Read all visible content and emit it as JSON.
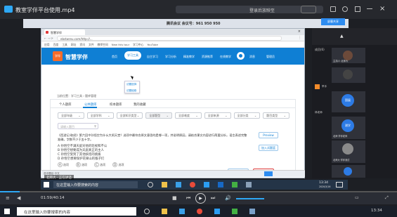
{
  "player": {
    "title": "教室学伴平台使用.mp4",
    "meeting": "腾讯会议",
    "controls": "登录后放映至",
    "close": "×"
  },
  "meeting": {
    "title": "腾讯会议 会议号：961 950 950",
    "share_label": "屏幕共享"
  },
  "browser": {
    "tab": "智慧学伴",
    "url": "ebstwreu.com/http://...",
    "bookmarks": [
      "应用",
      "百度",
      "工具",
      "网址",
      "资讯",
      "文件",
      "教师空间",
      "New this tour",
      "学习中心",
      "YouTube"
    ],
    "brand_short": "学伴",
    "brand": "智慧学伴",
    "nav": [
      "首页",
      "学习工具",
      "自主学习",
      "学习分析",
      "精准教学",
      "资源推荐",
      "在线教学"
    ],
    "nav_active": 1,
    "nav_right": [
      "消息",
      "管理员"
    ],
    "dropdown": [
      "试题选择",
      "试题组卷"
    ],
    "breadcrumb": "当前位置：学习工具 › 题库管理",
    "tabs": [
      "个人题库",
      "公共题库",
      "校本题库",
      "我的收藏"
    ],
    "tab_active": 1,
    "filters": [
      "全部年级",
      "全部学科",
      "全部知识类型",
      "全部题型",
      "全部难度",
      "全部来源",
      "全部分类",
      "题目类型"
    ],
    "search_placeholder": "请输入题目",
    "question": "《西游记·取经》第六回中孙悟空为什么大闹天宫？选项中最符合原文意思的是哪一项，并说明原因，请结合课文内容进行简要分析，语言表述完整准确，字数不少于五十字。",
    "options": [
      "A 孙悟空不满天庭对他的轻视和不公",
      "B 孙悟空想要成为天庭真正的主人",
      "C 孙悟空受到了其他妖怪的挑拨",
      "D 孙悟空想要保护花果山的猴子们"
    ],
    "answer_letters": [
      "A",
      "B",
      "C",
      "D"
    ],
    "answer_words": [
      "选项",
      "选项",
      "选项",
      "选项"
    ],
    "meta": "难度：中等  来源：公共题库  更新时间：2020-02-20",
    "preview": "Preview",
    "add_btn": "加入试题篮",
    "footer_btns": [
      "加入试卷",
      "加入试题篮"
    ],
    "status": "选中题目 中文"
  },
  "sidebar": {
    "host_label": "成员(6)",
    "p1": "主持人·北师大",
    "names": [
      "林老师",
      "国展",
      "湘学",
      "北师·学伴老师",
      "北师大·学伴测试"
    ],
    "badges": [
      "国展",
      "湘学"
    ],
    "mute": "全员静音",
    "hand": "举手"
  },
  "speaker": "北师大 · 正在讲话",
  "win_search": "在这里输入你要搜索的内容",
  "clock": {
    "time": "13:34",
    "date": "2020/3/16"
  },
  "progress": {
    "elapsed": "01:59/40:14",
    "fraction": 0.05
  },
  "clock2": {
    "time": "13:34"
  },
  "colors": {
    "primary": "#0f7fd4",
    "highlight": "#e03b3b"
  }
}
